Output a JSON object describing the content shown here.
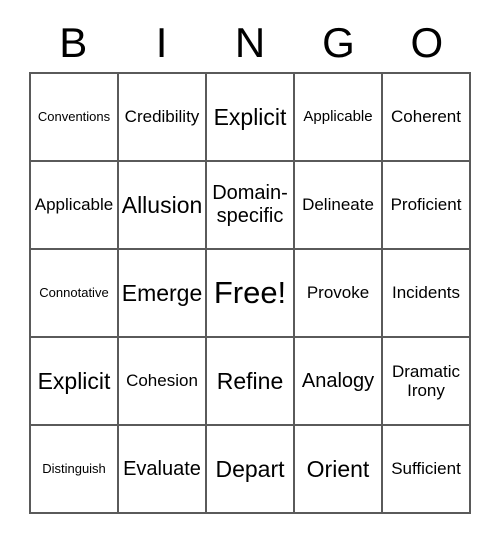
{
  "card": {
    "title_letters": [
      "B",
      "I",
      "N",
      "G",
      "O"
    ],
    "border_color": "#5a5a5a",
    "text_color": "#000000",
    "background_color": "#ffffff",
    "rows": 5,
    "columns": 5,
    "free_space": "Free!",
    "free_space_position": {
      "row": 3,
      "column": 3
    }
  },
  "cells": [
    {
      "text": "Conventions",
      "size": "fs-xs"
    },
    {
      "text": "Credibility",
      "size": "fs-md"
    },
    {
      "text": "Explicit",
      "size": "fs-xl"
    },
    {
      "text": "Applicable",
      "size": "fs-sm"
    },
    {
      "text": "Coherent",
      "size": "fs-md"
    },
    {
      "text": "Applicable",
      "size": "fs-md"
    },
    {
      "text": "Allusion",
      "size": "fs-xl"
    },
    {
      "text": "Domain-\nspecific",
      "size": "fs-lg"
    },
    {
      "text": "Delineate",
      "size": "fs-md"
    },
    {
      "text": "Proficient",
      "size": "fs-md"
    },
    {
      "text": "Connotative",
      "size": "fs-xs"
    },
    {
      "text": "Emerge",
      "size": "fs-xl"
    },
    {
      "text": "Free!",
      "size": "fs-xxl"
    },
    {
      "text": "Provoke",
      "size": "fs-md"
    },
    {
      "text": "Incidents",
      "size": "fs-md"
    },
    {
      "text": "Explicit",
      "size": "fs-xl"
    },
    {
      "text": "Cohesion",
      "size": "fs-md"
    },
    {
      "text": "Refine",
      "size": "fs-xl"
    },
    {
      "text": "Analogy",
      "size": "fs-lg"
    },
    {
      "text": "Dramatic\nIrony",
      "size": "fs-md"
    },
    {
      "text": "Distinguish",
      "size": "fs-xs"
    },
    {
      "text": "Evaluate",
      "size": "fs-lg"
    },
    {
      "text": "Depart",
      "size": "fs-xl"
    },
    {
      "text": "Orient",
      "size": "fs-xl"
    },
    {
      "text": "Sufficient",
      "size": "fs-md"
    }
  ]
}
